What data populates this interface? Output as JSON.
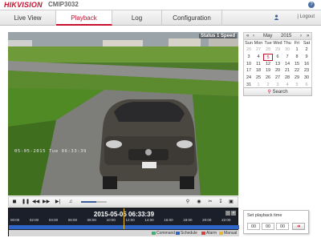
{
  "header": {
    "brand_hik": "HIK",
    "brand_vision": "VISION",
    "model": "CMIP3032",
    "help": "?"
  },
  "nav": {
    "tabs": [
      {
        "label": "Live View"
      },
      {
        "label": "Playback"
      },
      {
        "label": "Log"
      },
      {
        "label": "Configuration"
      }
    ],
    "logout": "Logout"
  },
  "video": {
    "status": "Status  1 Speed",
    "timestamp": "05-05-2015 Tue 06:33:39"
  },
  "controls": {
    "volume": 0.6
  },
  "timeline": {
    "datetime": "2015-05-05 06:33:39",
    "ticks": [
      "00:00",
      "02:00",
      "04:00",
      "06:00",
      "08:00",
      "10:00",
      "12:00",
      "14:00",
      "16:00",
      "18:00",
      "20:00",
      "22:00",
      "00:00"
    ],
    "legend": [
      {
        "label": "Command",
        "color": "#3cb371"
      },
      {
        "label": "Schedule",
        "color": "#2f65c9"
      },
      {
        "label": "Alarm",
        "color": "#d94040"
      },
      {
        "label": "Manual",
        "color": "#e8b33a"
      }
    ]
  },
  "calendar": {
    "month": "May",
    "year": "2015",
    "weekdays": [
      "Sun",
      "Mon",
      "Tue",
      "Wed",
      "Thu",
      "Fri",
      "Sat"
    ],
    "days": [
      [
        "26",
        "27",
        "28",
        "29",
        "30",
        "1",
        "2"
      ],
      [
        "3",
        "4",
        "5",
        "6",
        "7",
        "8",
        "9"
      ],
      [
        "10",
        "11",
        "12",
        "13",
        "14",
        "15",
        "16"
      ],
      [
        "17",
        "18",
        "19",
        "20",
        "21",
        "22",
        "23"
      ],
      [
        "24",
        "25",
        "26",
        "27",
        "28",
        "29",
        "30"
      ],
      [
        "31",
        "1",
        "2",
        "3",
        "4",
        "5",
        "6"
      ]
    ],
    "selected": "5",
    "search": "Search"
  },
  "playback_time": {
    "label": "Set playback time",
    "hh": "00",
    "mm": "00",
    "ss": "00"
  }
}
